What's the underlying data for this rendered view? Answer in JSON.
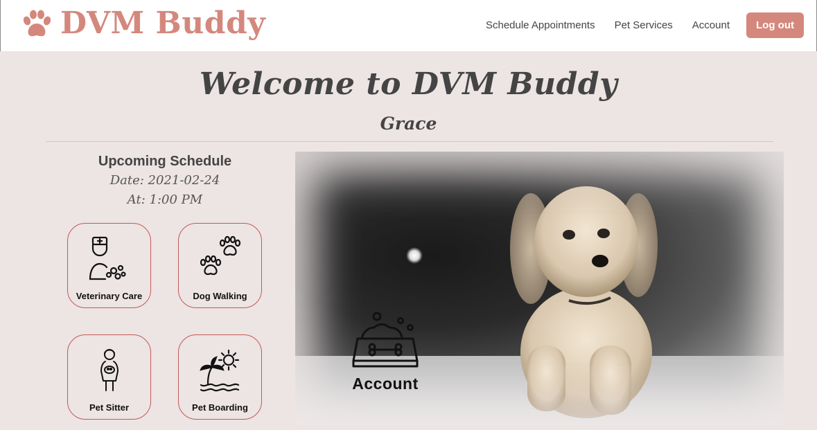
{
  "brand": {
    "name": "DVM Buddy",
    "color": "#d4887d",
    "icon": "paw-icon"
  },
  "nav": {
    "links": [
      "Schedule Appointments",
      "Pet Services",
      "Account"
    ],
    "logout_label": "Log out"
  },
  "page": {
    "welcome": "Welcome to DVM Buddy",
    "user_name": "Grace"
  },
  "schedule": {
    "title": "Upcoming Schedule",
    "date": "Date: 2021-02-24",
    "time": "At: 1:00 PM"
  },
  "services": [
    {
      "label": "Veterinary Care",
      "icon": "vet-icon"
    },
    {
      "label": "Dog Walking",
      "icon": "paw-prints-icon"
    },
    {
      "label": "Pet Sitter",
      "icon": "pet-sitter-icon"
    },
    {
      "label": "Pet Boarding",
      "icon": "beach-sun-icon"
    }
  ],
  "hero": {
    "account_label": "Account",
    "icon": "pet-bowl-icon"
  },
  "colors": {
    "accent": "#d4887d",
    "background": "#ede4e4",
    "card_border": "#c05a55",
    "text": "#444444"
  }
}
